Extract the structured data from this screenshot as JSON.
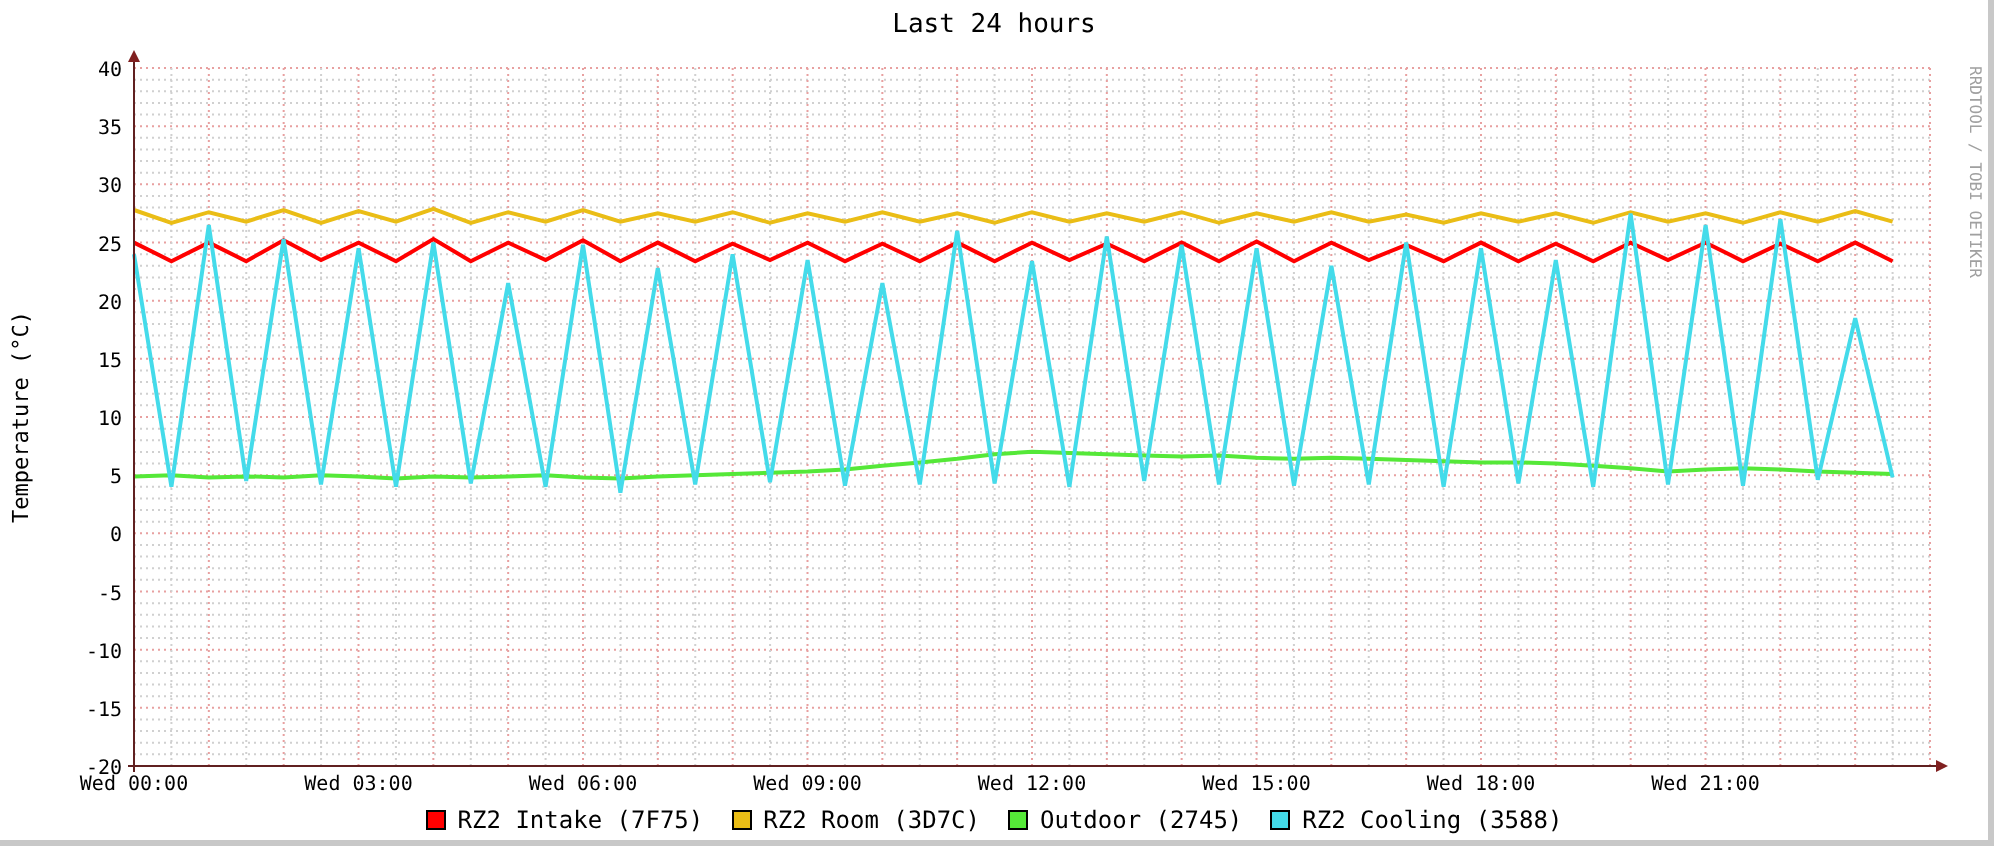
{
  "graph": {
    "watermark": "RRDTOOL / TOBI OETIKER",
    "chart_data": {
      "type": "line",
      "title": "Last 24 hours",
      "ylabel": "Temperature (°C)",
      "categories": [
        "Wed 00:00",
        null,
        null,
        null,
        null,
        null,
        "Wed 03:00",
        null,
        null,
        null,
        null,
        null,
        "Wed 06:00",
        null,
        null,
        null,
        null,
        null,
        "Wed 09:00",
        null,
        null,
        null,
        null,
        null,
        "Wed 12:00",
        null,
        null,
        null,
        null,
        null,
        "Wed 15:00",
        null,
        null,
        null,
        null,
        null,
        "Wed 18:00",
        null,
        null,
        null,
        null,
        null,
        "Wed 21:00",
        null,
        null,
        null,
        null,
        null
      ],
      "ylim": [
        -20,
        40
      ],
      "grid": true,
      "yticks": [
        -20,
        -15,
        -10,
        -5,
        0,
        5,
        10,
        15,
        20,
        25,
        30,
        35,
        40
      ],
      "series": [
        {
          "name": "RZ2 Intake (7F75)",
          "color": "#ff0000",
          "values": [
            25,
            23.4,
            25,
            23.4,
            25.2,
            23.5,
            25,
            23.4,
            25.3,
            23.4,
            25,
            23.5,
            25.2,
            23.4,
            25,
            23.4,
            24.9,
            23.5,
            25,
            23.4,
            24.9,
            23.4,
            25,
            23.4,
            25,
            23.5,
            24.9,
            23.4,
            25,
            23.4,
            25.1,
            23.4,
            25,
            23.5,
            24.8,
            23.4,
            25,
            23.4,
            24.9,
            23.4,
            25,
            23.5,
            25,
            23.4,
            24.9,
            23.4,
            25,
            23.4
          ]
        },
        {
          "name": "RZ2 Room (3D7C)",
          "color": "#eabd16",
          "values": [
            27.8,
            26.7,
            27.6,
            26.8,
            27.8,
            26.7,
            27.7,
            26.8,
            27.9,
            26.7,
            27.6,
            26.8,
            27.8,
            26.8,
            27.5,
            26.8,
            27.6,
            26.7,
            27.5,
            26.8,
            27.6,
            26.8,
            27.5,
            26.7,
            27.6,
            26.8,
            27.5,
            26.8,
            27.6,
            26.7,
            27.5,
            26.8,
            27.6,
            26.8,
            27.4,
            26.7,
            27.5,
            26.8,
            27.5,
            26.7,
            27.6,
            26.8,
            27.5,
            26.7,
            27.6,
            26.8,
            27.7,
            26.8
          ]
        },
        {
          "name": "Outdoor (2745)",
          "color": "#55e838",
          "values": [
            4.9,
            5,
            4.8,
            4.9,
            4.8,
            5,
            4.9,
            4.7,
            4.9,
            4.8,
            4.9,
            5,
            4.8,
            4.7,
            4.9,
            5,
            5.1,
            5.2,
            5.3,
            5.5,
            5.8,
            6.1,
            6.4,
            6.8,
            7,
            6.9,
            6.8,
            6.7,
            6.6,
            6.7,
            6.5,
            6.4,
            6.5,
            6.4,
            6.3,
            6.2,
            6.1,
            6.1,
            6,
            5.8,
            5.6,
            5.3,
            5.5,
            5.6,
            5.5,
            5.3,
            5.2,
            5.1
          ]
        },
        {
          "name": "RZ2 Cooling (3588)",
          "color": "#44dbea",
          "values": [
            24,
            4,
            26.5,
            4.5,
            25.3,
            4.2,
            24.5,
            4,
            25,
            4.3,
            21.5,
            4,
            24.8,
            3.5,
            22.8,
            4.2,
            24,
            4.4,
            23.5,
            4.1,
            21.5,
            4.2,
            26,
            4.3,
            23.4,
            4,
            25.5,
            4.5,
            24.8,
            4.2,
            24.5,
            4.1,
            23,
            4.2,
            25,
            4,
            24.5,
            4.3,
            23.5,
            4,
            27.5,
            4.2,
            26.5,
            4.1,
            27,
            4.6,
            18.5,
            4.8
          ]
        }
      ]
    }
  }
}
